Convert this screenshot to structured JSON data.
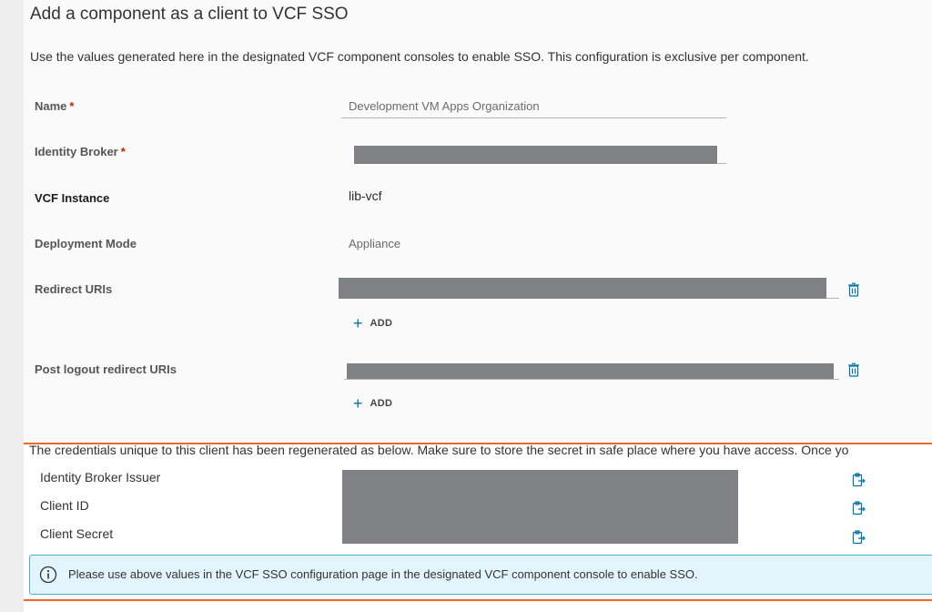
{
  "dialog": {
    "title": "Add a component as a client to VCF SSO",
    "intro": "Use the values generated here in the designated VCF component consoles to enable SSO. This configuration is exclusive per component."
  },
  "form": {
    "name": {
      "label": "Name",
      "required": "*",
      "value": "Development VM Apps Organization"
    },
    "identity_broker": {
      "label": "Identity Broker",
      "required": "*"
    },
    "vcf_instance": {
      "label": "VCF Instance",
      "value": "lib-vcf"
    },
    "deployment_mode": {
      "label": "Deployment Mode",
      "value": "Appliance"
    },
    "redirect_uris": {
      "label": "Redirect URIs",
      "add_label": "ADD"
    },
    "post_logout_uris": {
      "label": "Post logout redirect URIs",
      "add_label": "ADD"
    }
  },
  "credentials": {
    "note": "The credentials unique to this client has been regenerated as below. Make sure to store the secret in safe place where you have access. Once yo",
    "rows": [
      {
        "label": "Identity Broker Issuer"
      },
      {
        "label": "Client ID"
      },
      {
        "label": "Client Secret"
      }
    ]
  },
  "alert": {
    "icon": "info-icon",
    "text": "Please use above values in the VCF SSO configuration page in the designated VCF component console to enable SSO."
  },
  "colors": {
    "accent": "#0072a3",
    "required": "#c92100",
    "highlight_border": "#f06a25",
    "redaction": "#808184",
    "info_bg": "#e3f5fc",
    "info_border": "#49afd9"
  }
}
